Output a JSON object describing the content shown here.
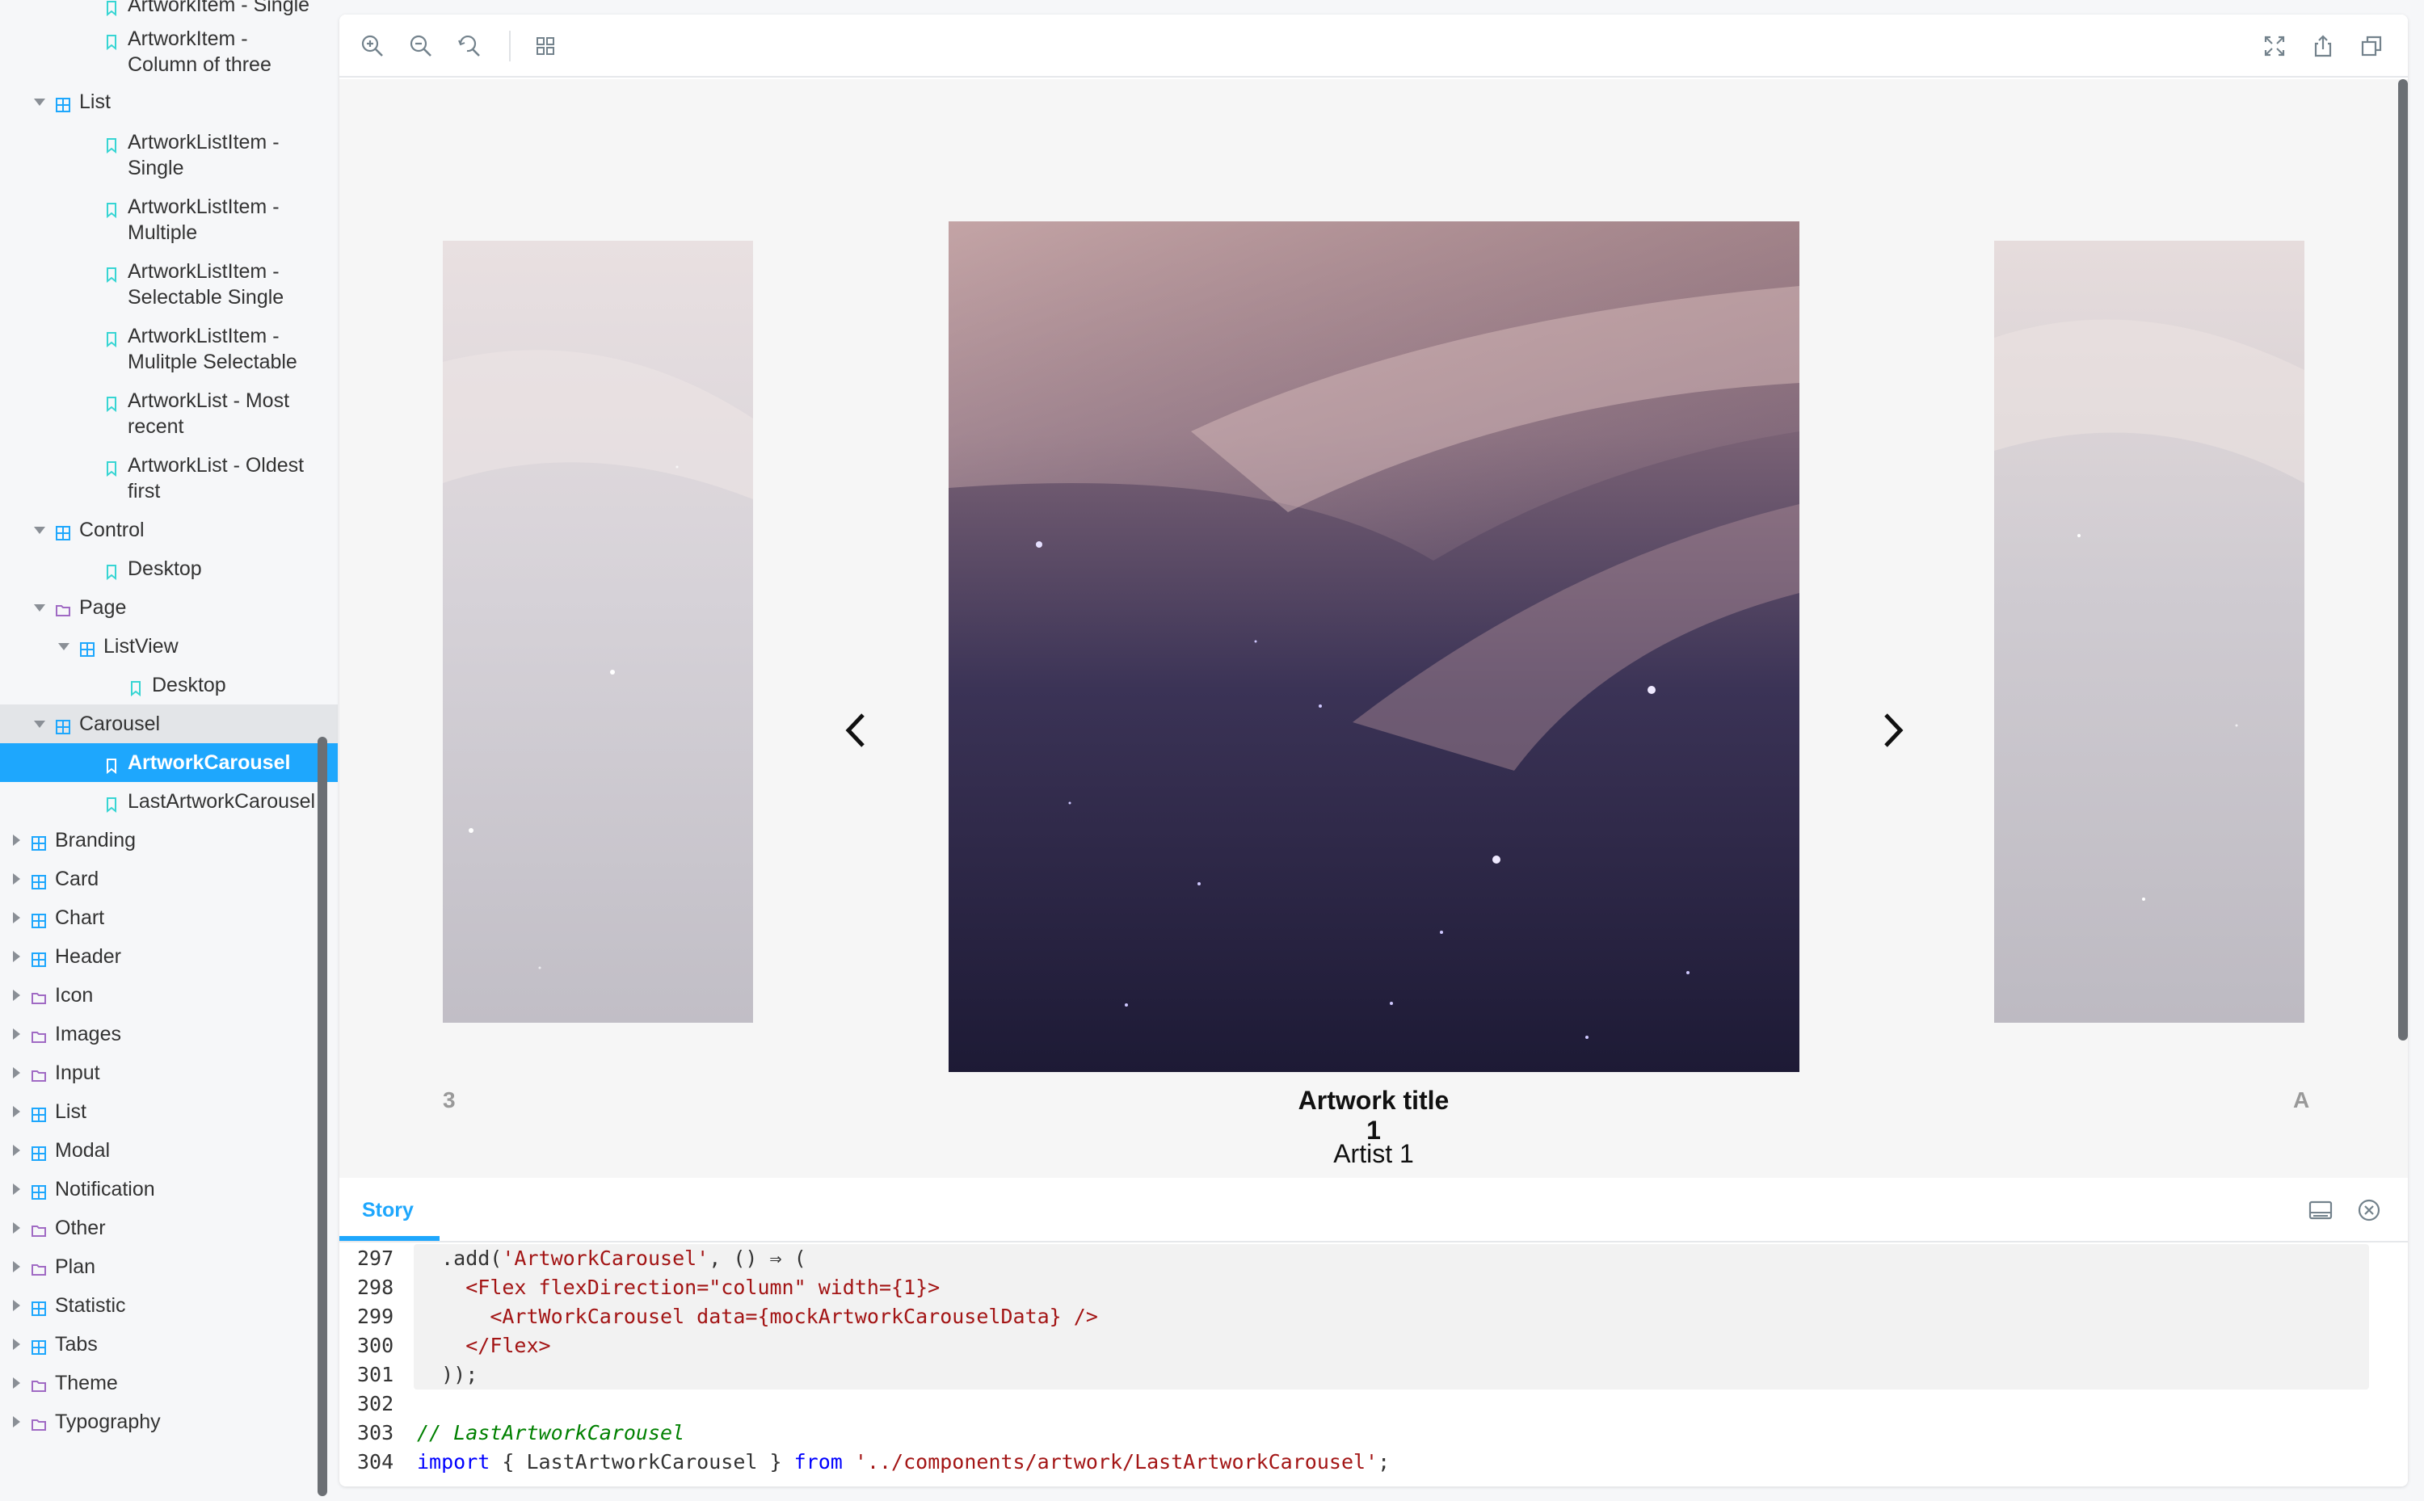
{
  "sidebar": {
    "items": [
      {
        "label": "ArtworkItem - Single",
        "type": "story"
      },
      {
        "label": "ArtworkItem -\nColumn of three",
        "type": "story"
      },
      {
        "label": "List",
        "type": "component"
      },
      {
        "label": "ArtworkListItem -\nSingle",
        "type": "story"
      },
      {
        "label": "ArtworkListItem -\nMultiple",
        "type": "story"
      },
      {
        "label": "ArtworkListItem -\nSelectable Single",
        "type": "story"
      },
      {
        "label": "ArtworkListItem -\nMulitple Selectable",
        "type": "story"
      },
      {
        "label": "ArtworkList - Most\nrecent",
        "type": "story"
      },
      {
        "label": "ArtworkList - Oldest\nfirst",
        "type": "story"
      },
      {
        "label": "Control",
        "type": "component"
      },
      {
        "label": "Desktop",
        "type": "story"
      },
      {
        "label": "Page",
        "type": "folder"
      },
      {
        "label": "ListView",
        "type": "component"
      },
      {
        "label": "Desktop",
        "type": "story"
      },
      {
        "label": "Carousel",
        "type": "component"
      },
      {
        "label": "ArtworkCarousel",
        "type": "story",
        "selected": true
      },
      {
        "label": "LastArtworkCarousel",
        "type": "story"
      },
      {
        "label": "Branding",
        "type": "component"
      },
      {
        "label": "Card",
        "type": "component"
      },
      {
        "label": "Chart",
        "type": "component"
      },
      {
        "label": "Header",
        "type": "component"
      },
      {
        "label": "Icon",
        "type": "folder"
      },
      {
        "label": "Images",
        "type": "folder"
      },
      {
        "label": "Input",
        "type": "folder"
      },
      {
        "label": "List",
        "type": "component"
      },
      {
        "label": "Modal",
        "type": "component"
      },
      {
        "label": "Notification",
        "type": "component"
      },
      {
        "label": "Other",
        "type": "folder"
      },
      {
        "label": "Plan",
        "type": "folder"
      },
      {
        "label": "Statistic",
        "type": "component"
      },
      {
        "label": "Tabs",
        "type": "component"
      },
      {
        "label": "Theme",
        "type": "folder"
      },
      {
        "label": "Typography",
        "type": "folder"
      }
    ]
  },
  "toolbar": {
    "icons": [
      "zoom-in-icon",
      "zoom-out-icon",
      "zoom-reset-icon",
      "grid-icon",
      "fullscreen-icon",
      "share-icon",
      "copy-icon"
    ]
  },
  "carousel": {
    "title": "Artwork title 1",
    "artist": "Artist 1",
    "prev_ghost": "3",
    "next_ghost": "A"
  },
  "addons": {
    "tab_story": "Story"
  },
  "code": {
    "lines": [
      {
        "n": "297",
        "parts": [
          [
            "def",
            "  .add("
          ],
          [
            "str",
            "'ArtworkCarousel'"
          ],
          [
            "def",
            ", () ⇒ ("
          ]
        ]
      },
      {
        "n": "298",
        "parts": [
          [
            "def",
            "    "
          ],
          [
            "tag",
            "<Flex flexDirection=\"column\" width={1}>"
          ]
        ]
      },
      {
        "n": "299",
        "parts": [
          [
            "def",
            "      "
          ],
          [
            "tag",
            "<ArtWorkCarousel data={mockArtworkCarouselData} />"
          ]
        ]
      },
      {
        "n": "300",
        "parts": [
          [
            "def",
            "    "
          ],
          [
            "tag",
            "</Flex>"
          ]
        ]
      },
      {
        "n": "301",
        "parts": [
          [
            "def",
            "  ));"
          ]
        ]
      },
      {
        "n": "302",
        "parts": [
          [
            "def",
            ""
          ]
        ]
      },
      {
        "n": "303",
        "parts": [
          [
            "cmt",
            "// LastArtworkCarousel"
          ]
        ]
      },
      {
        "n": "304",
        "parts": [
          [
            "kw",
            "import"
          ],
          [
            "def",
            " { LastArtworkCarousel } "
          ],
          [
            "kw",
            "from"
          ],
          [
            "def",
            " "
          ],
          [
            "str",
            "'../components/artwork/LastArtworkCarousel'"
          ],
          [
            "def",
            ";"
          ]
        ]
      }
    ]
  },
  "colors": {
    "accent": "#1ea7fd",
    "sidebar_bg": "#f6f7f9"
  }
}
